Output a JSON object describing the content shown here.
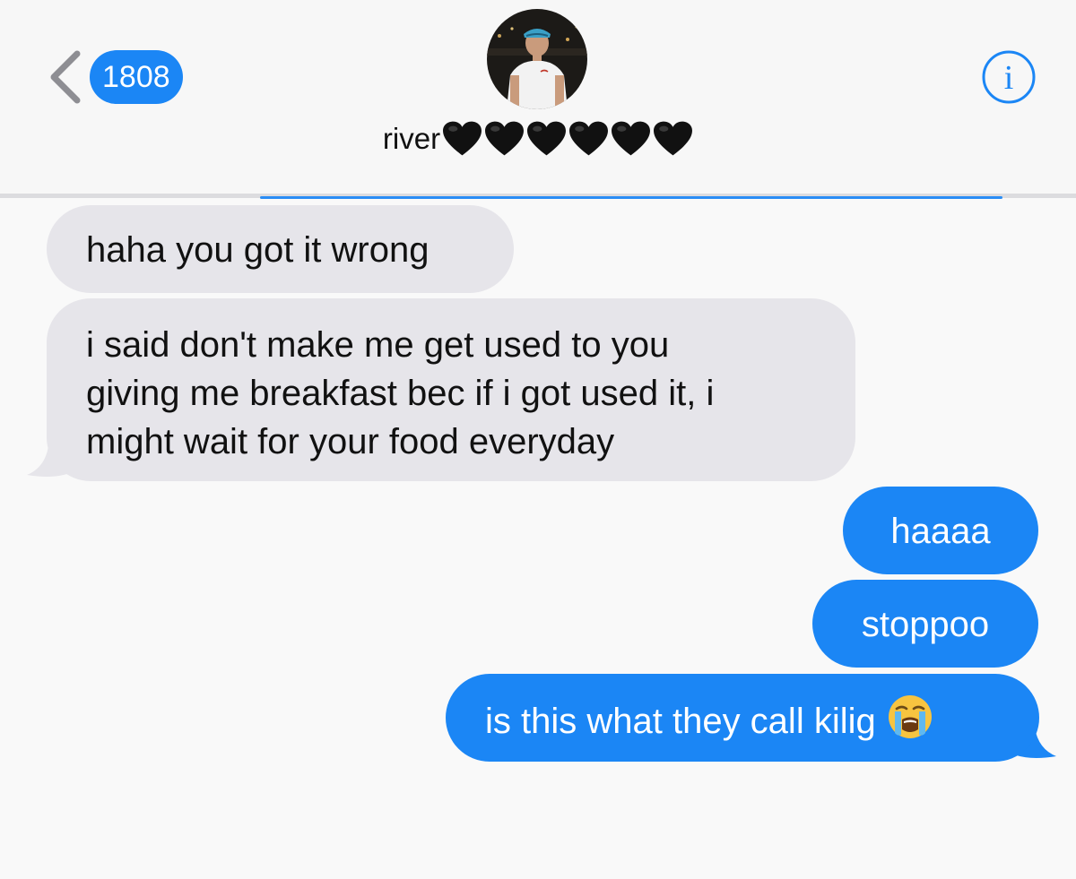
{
  "header": {
    "back_count": "1808",
    "contact_name": "river",
    "name_emoji_icon": "black-heart-icon",
    "name_emoji_count": 6,
    "info_icon": "info-icon"
  },
  "colors": {
    "accent": "#1b86f5",
    "received_bubble": "#e6e5ea",
    "background": "#f9f9f9"
  },
  "messages": [
    {
      "direction": "received",
      "text": "haha you got it wrong"
    },
    {
      "direction": "received",
      "lines": [
        "i said don't make me get used to you",
        "giving me breakfast bec if i got used it, i",
        "might wait for your food everyday"
      ]
    },
    {
      "direction": "sent",
      "text": "haaaa"
    },
    {
      "direction": "sent",
      "text": "stoppoo"
    },
    {
      "direction": "sent",
      "text": "is this what they call kilig",
      "emoji_icon": "loudly-crying-face-icon"
    }
  ]
}
